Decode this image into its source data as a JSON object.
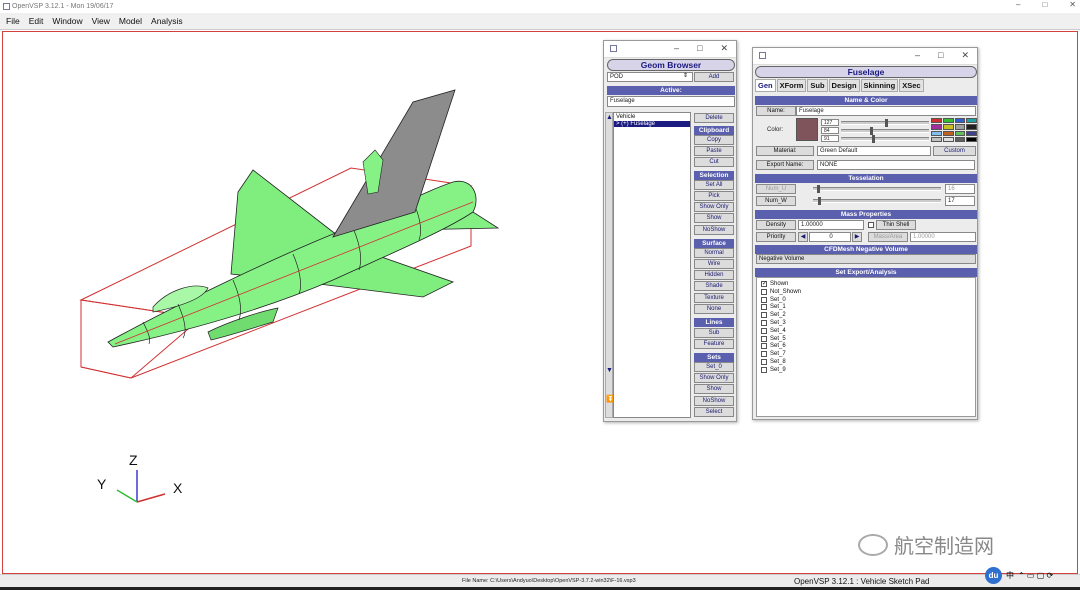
{
  "window": {
    "title": "OpenVSP 3.12.1 - Mon 19/06/17"
  },
  "menu": [
    "File",
    "Edit",
    "Window",
    "View",
    "Model",
    "Analysis"
  ],
  "axes": {
    "z": "Z",
    "y": "Y",
    "x": "X"
  },
  "geom_browser": {
    "title": "Geom Browser",
    "type_select": "POD",
    "add_label": "Add",
    "active_header": "Active:",
    "active_value": "Fuselage",
    "tree": [
      "Vehicle",
      "> (+) Fuselage"
    ],
    "delete": "Delete",
    "clipboard": {
      "header": "Clipboard",
      "copy": "Copy",
      "paste": "Paste",
      "cut": "Cut"
    },
    "selection": {
      "header": "Selection",
      "set_all": "Set All",
      "pick": "Pick",
      "show_only": "Show Only",
      "show": "Show",
      "noshow": "NoShow"
    },
    "surface": {
      "header": "Surface",
      "normal": "Normal",
      "wire": "Wire",
      "hidden": "Hidden",
      "shade": "Shade",
      "texture": "Texture",
      "none": "None"
    },
    "lines": {
      "header": "Lines",
      "sub": "Sub",
      "feature": "Feature"
    },
    "sets": {
      "header": "Sets",
      "set_select": "Set_0",
      "show_only": "Show Only",
      "show": "Show",
      "noshow": "NoShow",
      "select": "Select"
    }
  },
  "fuselage": {
    "title": "Fuselage",
    "tabs": [
      "Gen",
      "XForm",
      "Sub",
      "Design",
      "Skinning",
      "XSec"
    ],
    "name_color_header": "Name & Color",
    "name_label": "Name:",
    "name_value": "Fuselage",
    "color_label": "Color:",
    "color_rgb": [
      "127",
      "84",
      "91"
    ],
    "swatch_color": "#7f545b",
    "palette": [
      "#d23030",
      "#30c030",
      "#3060d0",
      "#20a0a0",
      "#a030a0",
      "#c8c020",
      "#a0a0a0",
      "#202020",
      "#80c0f0",
      "#c06020",
      "#60c060",
      "#404090",
      "#c0c0c0",
      "#e0e0e0",
      "#606060",
      "#000000"
    ],
    "material_label": "Material:",
    "material_value": "Green Default",
    "custom_label": "Custom",
    "export_label": "Export Name:",
    "export_value": "NONE",
    "tesselation_header": "Tesselation",
    "num_u_label": "Num_U",
    "num_u_value": "16",
    "num_w_label": "Num_W",
    "num_w_value": "17",
    "mass_header": "Mass Properties",
    "density_label": "Density",
    "density_value": "1.00000",
    "thin_shell": "Thin Shell",
    "priority_label": "Priority",
    "priority_value": "0",
    "mass_area_label": "Mass/Area",
    "mass_area_value": "1.00000",
    "cfd_header": "CFDMesh Negative Volume",
    "negative_volume": "Negative Volume",
    "set_export_header": "Set Export/Analysis",
    "sets": [
      {
        "name": "Shown",
        "checked": true
      },
      {
        "name": "Not_Shown",
        "checked": false
      },
      {
        "name": "Set_0",
        "checked": false
      },
      {
        "name": "Set_1",
        "checked": false
      },
      {
        "name": "Set_2",
        "checked": false
      },
      {
        "name": "Set_3",
        "checked": false
      },
      {
        "name": "Set_4",
        "checked": false
      },
      {
        "name": "Set_5",
        "checked": false
      },
      {
        "name": "Set_6",
        "checked": false
      },
      {
        "name": "Set_7",
        "checked": false
      },
      {
        "name": "Set_8",
        "checked": false
      },
      {
        "name": "Set_9",
        "checked": false
      }
    ]
  },
  "statusbar": {
    "file": "File Name: C:\\Users\\Andyuo\\Desktop\\OpenVSP-3.7.2-win32\\F-16.vsp3",
    "app": "OpenVSP 3.12.1 : Vehicle Sketch Pad"
  },
  "tray": {
    "du": "du",
    "ime": "中"
  },
  "watermark": "航空制造网",
  "colors": {
    "accent": "#5a5fae",
    "model_green": "#7ff07f",
    "bbox": "#d23030"
  }
}
